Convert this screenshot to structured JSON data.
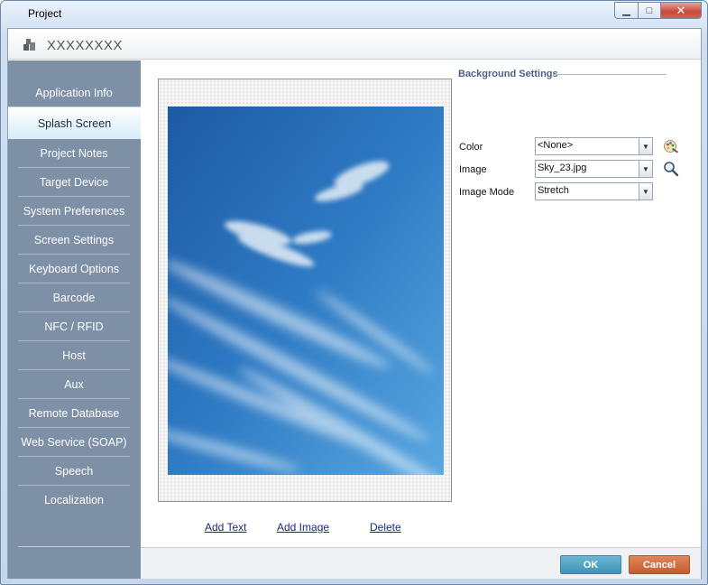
{
  "window": {
    "title": "Project"
  },
  "header": {
    "project_name": "XXXXXXXX"
  },
  "sidebar": {
    "items": [
      {
        "label": "Application Info",
        "active": false
      },
      {
        "label": "Splash Screen",
        "active": true
      },
      {
        "label": "Project Notes",
        "active": false
      },
      {
        "label": "Target Device",
        "active": false
      },
      {
        "label": "System Preferences",
        "active": false
      },
      {
        "label": "Screen Settings",
        "active": false
      },
      {
        "label": "Keyboard Options",
        "active": false
      },
      {
        "label": "Barcode",
        "active": false
      },
      {
        "label": "NFC / RFID",
        "active": false
      },
      {
        "label": "Host",
        "active": false
      },
      {
        "label": "Aux",
        "active": false
      },
      {
        "label": "Remote Database",
        "active": false
      },
      {
        "label": "Web Service (SOAP)",
        "active": false
      },
      {
        "label": "Speech",
        "active": false
      },
      {
        "label": "Localization",
        "active": false
      }
    ]
  },
  "preview": {
    "links": {
      "add_text": "Add Text",
      "add_image": "Add Image",
      "delete": "Delete"
    }
  },
  "background_settings": {
    "title": "Background Settings",
    "color": {
      "label": "Color",
      "value": "<None>",
      "icon": "color-picker-icon"
    },
    "image": {
      "label": "Image",
      "value": "Sky_23.jpg",
      "icon": "magnifier-icon"
    },
    "image_mode": {
      "label": "Image Mode",
      "value": "Stretch"
    }
  },
  "footer": {
    "ok_label": "OK",
    "cancel_label": "Cancel"
  },
  "colors": {
    "sidebar_bg": "#7e90a6",
    "ok_button": "#4a9fc2",
    "cancel_button": "#cf6a3b",
    "link": "#1a2c7a"
  }
}
